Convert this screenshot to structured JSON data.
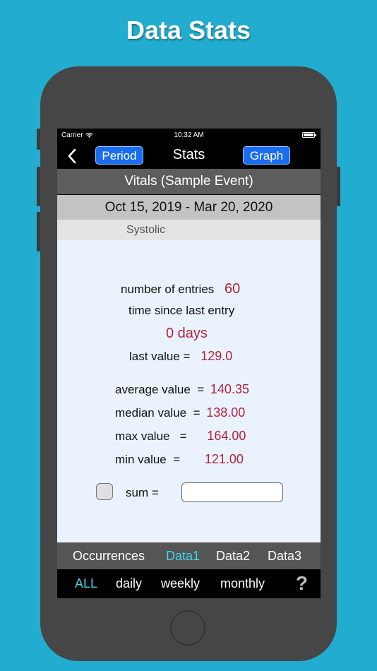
{
  "headline": "Data Stats",
  "status": {
    "carrier": "Carrier",
    "time": "10:32 AM"
  },
  "nav": {
    "back_icon": "chevron-left-icon",
    "period_label": "Period",
    "title": "Stats",
    "graph_label": "Graph"
  },
  "event_name": "Vitals (Sample Event)",
  "date_range": "Oct 15, 2019 - Mar 20, 2020",
  "metric": "Systolic",
  "stats": {
    "entries_label": "number of entries",
    "entries_value": "60",
    "since_label": "time since last entry",
    "since_value": "0 days",
    "last_label": "last value =",
    "last_value": "129.0",
    "average_label": "average value  =",
    "average_value": "140.35",
    "median_label": "median value  =",
    "median_value": "138.00",
    "max_label": "max value   =",
    "max_value": "164.00",
    "min_label": "min value  =",
    "min_value": "121.00",
    "sum_label": "sum =",
    "sum_value": "",
    "sum_checked": false
  },
  "type_tabs": [
    {
      "label": "Occurrences",
      "active": false
    },
    {
      "label": "Data1",
      "active": true
    },
    {
      "label": "Data2",
      "active": false
    },
    {
      "label": "Data3",
      "active": false
    }
  ],
  "period_tabs": [
    {
      "label": "ALL",
      "active": true
    },
    {
      "label": "daily",
      "active": false
    },
    {
      "label": "weekly",
      "active": false
    },
    {
      "label": "monthly",
      "active": false
    }
  ],
  "help_label": "?",
  "colors": {
    "background": "#22acd0",
    "accent_value": "#b3223d",
    "active_tab": "#3fd6ea",
    "button_blue": "#1a6df0"
  }
}
